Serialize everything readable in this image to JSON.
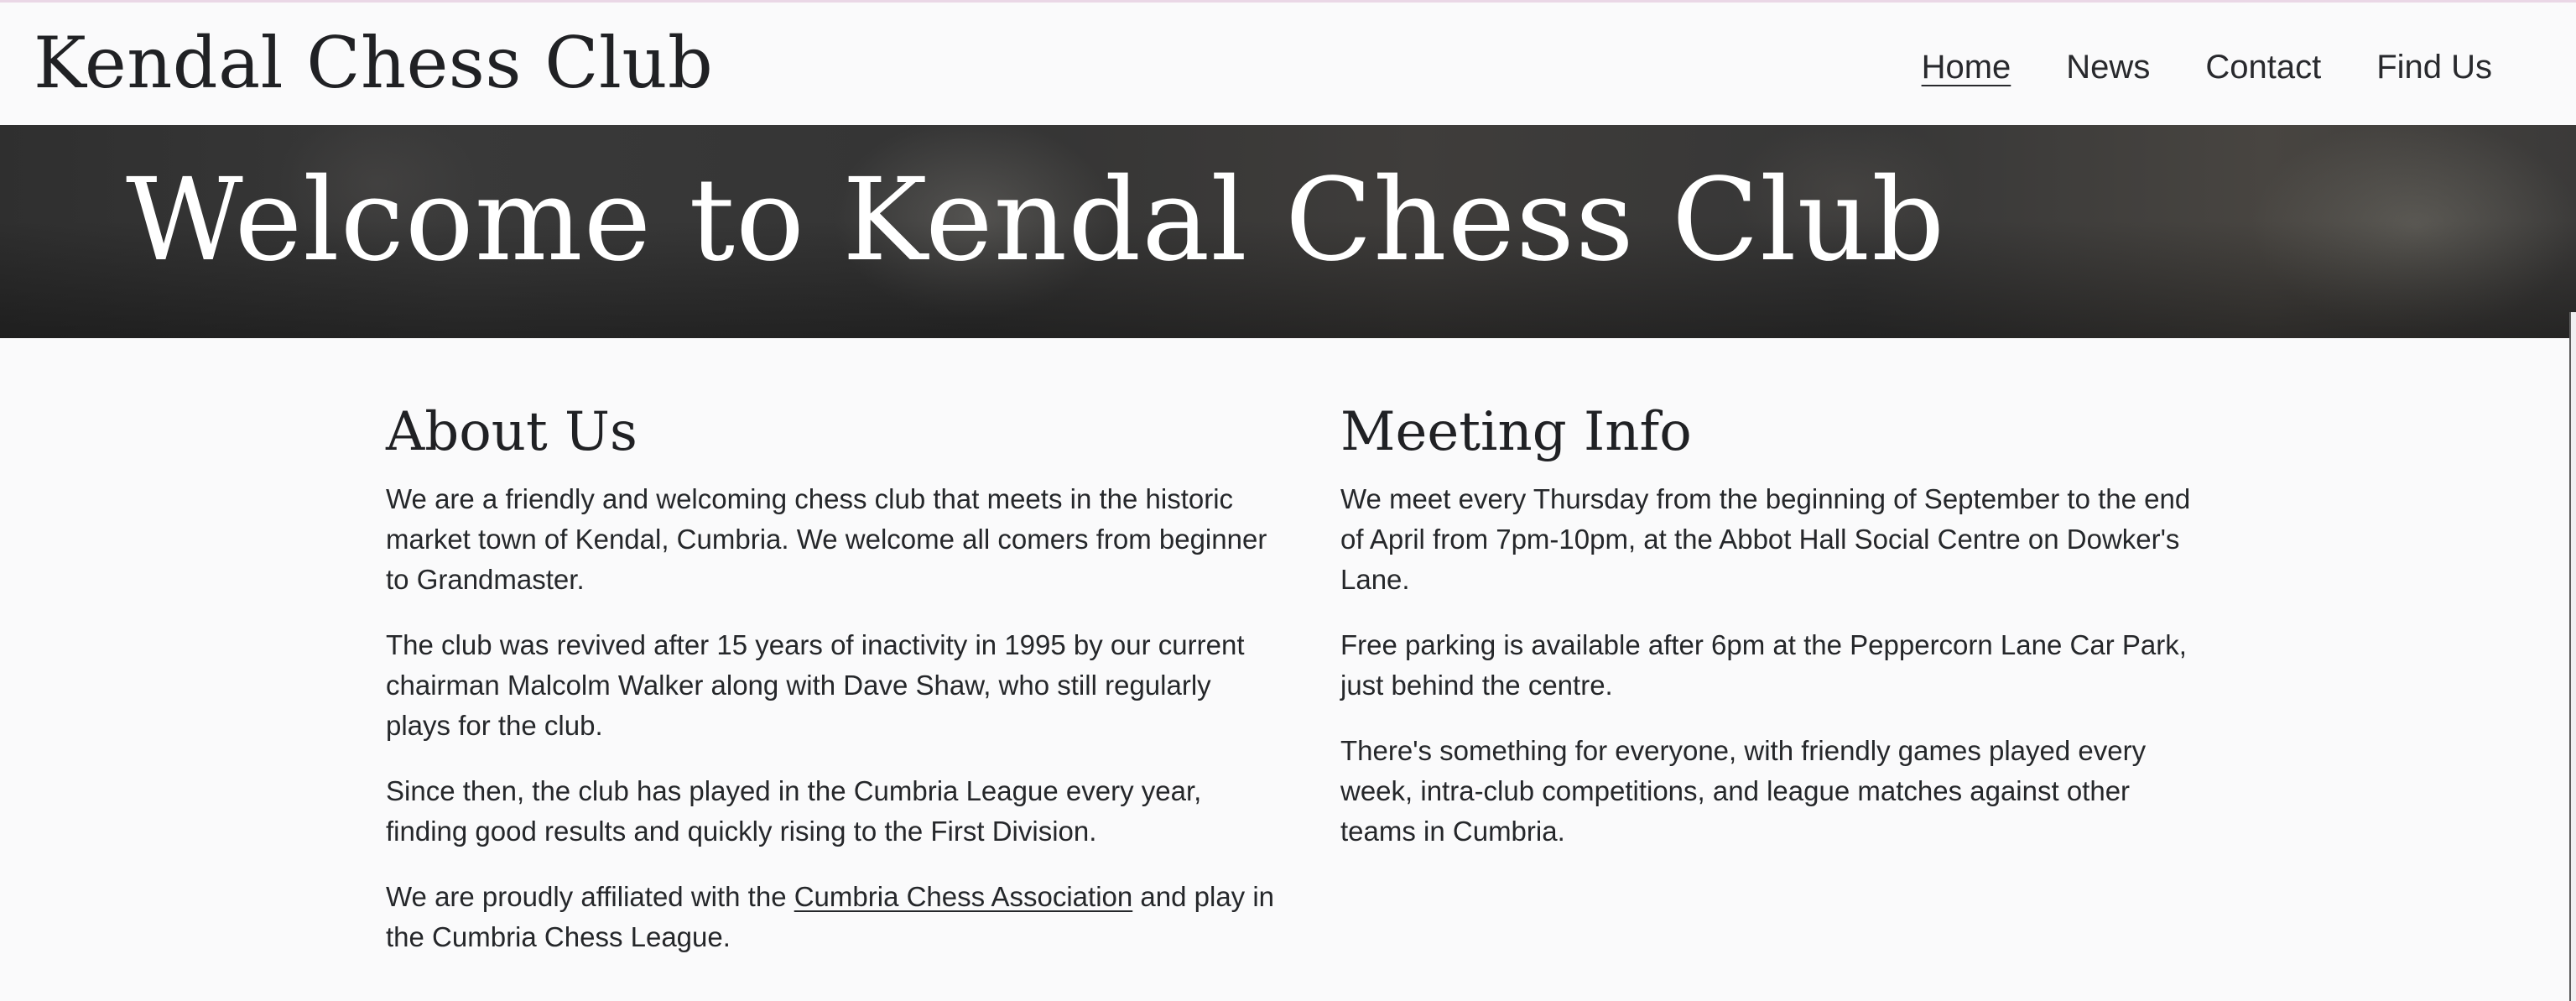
{
  "site": {
    "title": "Kendal Chess Club"
  },
  "nav": {
    "items": [
      {
        "label": "Home",
        "active": true
      },
      {
        "label": "News",
        "active": false
      },
      {
        "label": "Contact",
        "active": false
      },
      {
        "label": "Find Us",
        "active": false
      }
    ]
  },
  "hero": {
    "title": "Welcome to Kendal Chess Club"
  },
  "about": {
    "heading": "About Us",
    "p1": "We are a friendly and welcoming chess club that meets in the historic market town of Kendal, Cumbria. We welcome all comers from beginner to Grandmaster.",
    "p2": "The club was revived after 15 years of inactivity in 1995 by our current chairman Malcolm Walker along with Dave Shaw, who still regularly plays for the club.",
    "p3": "Since then, the club has played in the Cumbria League every year, finding good results and quickly rising to the First Division.",
    "p4_before": "We are proudly affiliated with the ",
    "p4_link": "Cumbria Chess Association",
    "p4_after": " and play in the Cumbria Chess League."
  },
  "meeting": {
    "heading": "Meeting Info",
    "p1": "We meet every Thursday from the beginning of September to the end of April from 7pm-10pm, at the Abbot Hall Social Centre on Dowker's Lane.",
    "p2": "Free parking is available after 6pm at the Peppercorn Lane Car Park, just behind the centre.",
    "p3": "There's something for everyone, with friendly games played every week, intra-club competitions, and league matches against other teams in Cumbria."
  }
}
